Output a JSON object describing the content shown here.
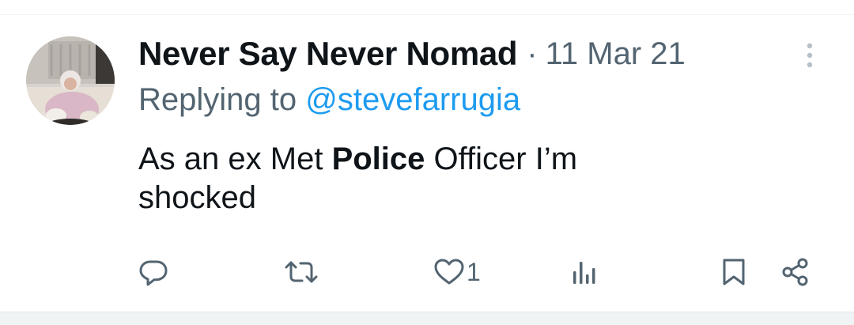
{
  "tweet": {
    "author_name": "Never Say Never Nomad",
    "separator": "·",
    "timestamp": "11 Mar 21",
    "replying_prefix": "Replying to",
    "replying_handle": "@stevefarrugia",
    "text_before": "As an ex Met",
    "text_bold": "Police",
    "text_after": "Officer I’m",
    "text_line2": "shocked"
  },
  "actions": {
    "reply_icon": "reply-bubble-icon",
    "retweet_icon": "retweet-icon",
    "like_icon": "heart-icon",
    "like_count": "1",
    "views_icon": "views-bar-icon",
    "bookmark_icon": "bookmark-icon",
    "share_icon": "share-icon"
  },
  "colors": {
    "text": "#0f1419",
    "secondary": "#536471",
    "accent": "#1d9bf0",
    "divider": "#eff3f4"
  }
}
